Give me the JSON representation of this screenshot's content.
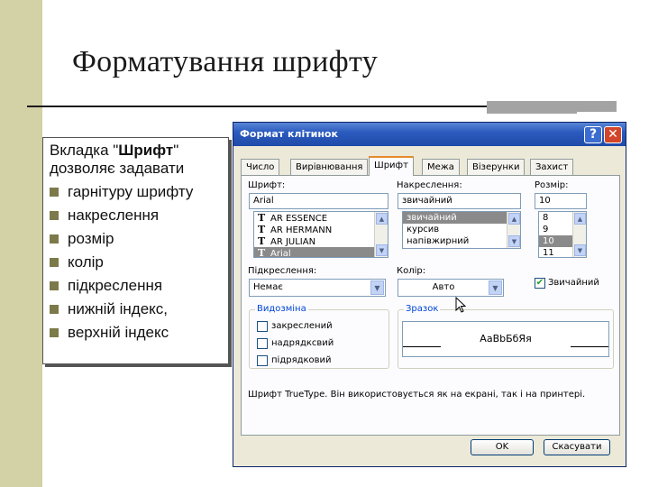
{
  "slide": {
    "title": "Форматування шрифту",
    "intro_pre": "Вкладка \"",
    "intro_bold": "Шрифт",
    "intro_post": "\" дозволяє задавати",
    "items": [
      "гарнітуру шрифту",
      "накреслення",
      "розмір",
      "колір",
      "підкреслення",
      "нижній індекс,",
      "верхній індекс"
    ]
  },
  "dialog": {
    "title": "Формат клітинок",
    "help_glyph": "?",
    "close_glyph": "✕",
    "tabs": [
      "Число",
      "Вирівнювання",
      "Шрифт",
      "Межа",
      "Візерунки",
      "Захист"
    ],
    "active_tab": "Шрифт",
    "font": {
      "label": "Шрифт:",
      "value": "Arial",
      "list": [
        "AR ESSENCE",
        "AR HERMANN",
        "AR JULIAN",
        "Arial"
      ],
      "tt_glyph": "T"
    },
    "style": {
      "label": "Накреслення:",
      "value": "звичайний",
      "list": [
        "звичайний",
        "курсив",
        "напівжирний"
      ]
    },
    "size": {
      "label": "Розмір:",
      "value": "10",
      "list": [
        "8",
        "9",
        "10",
        "11"
      ]
    },
    "underline": {
      "label": "Підкреслення:",
      "value": "Немає"
    },
    "color": {
      "label": "Колір:",
      "value": "Авто"
    },
    "normal_checkbox": {
      "label": "Звичайний",
      "checked": true
    },
    "effects": {
      "title": "Видозміна",
      "items": [
        "закреслений",
        "надрядксвий",
        "підрядковий"
      ]
    },
    "preview": {
      "title": "Зразок",
      "sample": "AaBbБбЯя"
    },
    "note": "Шрифт TrueType. Він використовується як на екрані, так і на принтері.",
    "ok": "OK",
    "cancel": "Скасувати"
  },
  "colors": {
    "accent_band": "#d3d1a6",
    "bullet": "#7c7a4a",
    "titlebar": "#2b5bbf",
    "dialog_bg": "#ece9d8",
    "selection": "#8a8a8a"
  }
}
